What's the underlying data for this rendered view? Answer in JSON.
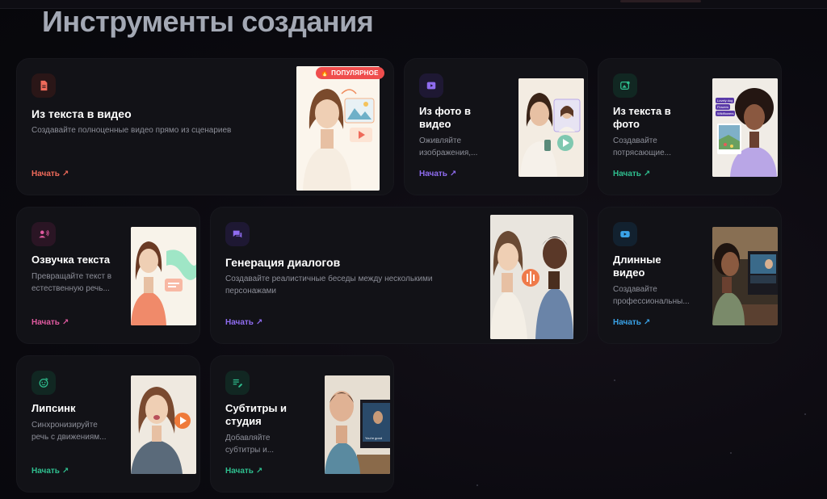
{
  "page": {
    "title": "Инструменты создания"
  },
  "cards": {
    "text_to_video": {
      "title": "Из текста в видео",
      "desc": "Создавайте полноценные видео прямо из сценариев",
      "start": "Начать",
      "badge": "ПОПУЛЯРНОЕ",
      "icon": "document-icon",
      "accent": "#ef6a5a"
    },
    "photo_to_video": {
      "title": "Из фото в видео",
      "desc": "Оживляйте изображения,...",
      "start": "Начать",
      "icon": "video-play-icon",
      "accent": "#8f6cf0"
    },
    "text_to_photo": {
      "title": "Из текста в фото",
      "desc": "Создавайте потрясающие...",
      "start": "Начать",
      "icon": "image-edit-icon",
      "accent": "#2fbf8f"
    },
    "voiceover": {
      "title": "Озвучка текста",
      "desc": "Превращайте текст в естественную речь...",
      "start": "Начать",
      "icon": "user-voice-icon",
      "accent": "#e05aa0"
    },
    "dialogs": {
      "title": "Генерация диалогов",
      "desc": "Создавайте реалистичные беседы между несколькими персонажами",
      "start": "Начать",
      "icon": "chat-bubbles-icon",
      "accent": "#8f6cf0"
    },
    "long_video": {
      "title": "Длинные видео",
      "desc": "Создавайте профессиональны...",
      "start": "Начать",
      "icon": "youtube-icon",
      "accent": "#3aa3e8"
    },
    "lipsync": {
      "title": "Липсинк",
      "desc": "Синхронизируйте речь с движениям...",
      "start": "Начать",
      "icon": "face-sync-icon",
      "accent": "#2fbf8f"
    },
    "subtitles": {
      "title": "Субтитры и студия",
      "desc": "Добавляйте субтитры и...",
      "start": "Начать",
      "icon": "subtitles-edit-icon",
      "accent": "#2fbf8f"
    }
  },
  "thumb_text": {
    "prompt_tags": [
      "Lovely dog",
      "Flowers",
      "Wildflowers"
    ],
    "tv_caption": "You're good"
  },
  "colors": {
    "background": "#0b0a10",
    "card": "#121217",
    "title": "#a3a8b4",
    "badge": "#ef4d4d"
  }
}
